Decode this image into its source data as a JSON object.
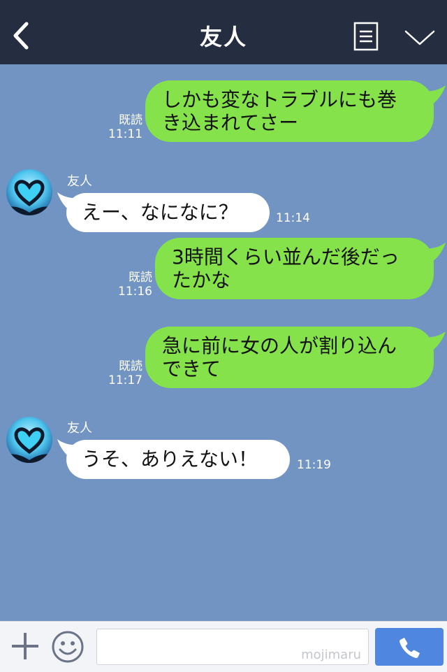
{
  "header": {
    "title": "友人",
    "back_icon": "chevron-left-icon",
    "notes_icon": "notes-icon",
    "menu_icon": "chevron-down-icon"
  },
  "messages": [
    {
      "side": "mine",
      "lines": [
        "しかも変なトラブルにも巻",
        "き込まれてさー"
      ],
      "read": "既読",
      "time": "11:11"
    },
    {
      "side": "theirs",
      "sender": "友人",
      "lines": [
        "えー、なになに？"
      ],
      "time": "11:14"
    },
    {
      "side": "mine",
      "lines": [
        "3時間くらい並んだ後だっ",
        "たかな"
      ],
      "read": "既読",
      "time": "11:16"
    },
    {
      "side": "mine",
      "lines": [
        "急に前に女の人が割り込ん",
        "できて"
      ],
      "read": "既読",
      "time": "11:17"
    },
    {
      "side": "theirs",
      "sender": "友人",
      "lines": [
        "うそ、ありえない！"
      ],
      "time": "11:19"
    }
  ],
  "input": {
    "watermark": "mojimaru",
    "plus_icon": "plus-icon",
    "sticker_icon": "smiley-icon",
    "call_icon": "phone-icon"
  },
  "colors": {
    "header_bg": "#252e41",
    "chat_bg": "#7294c2",
    "my_bubble": "#85e24b",
    "their_bubble": "#ffffff",
    "call_button": "#4f86e0"
  }
}
